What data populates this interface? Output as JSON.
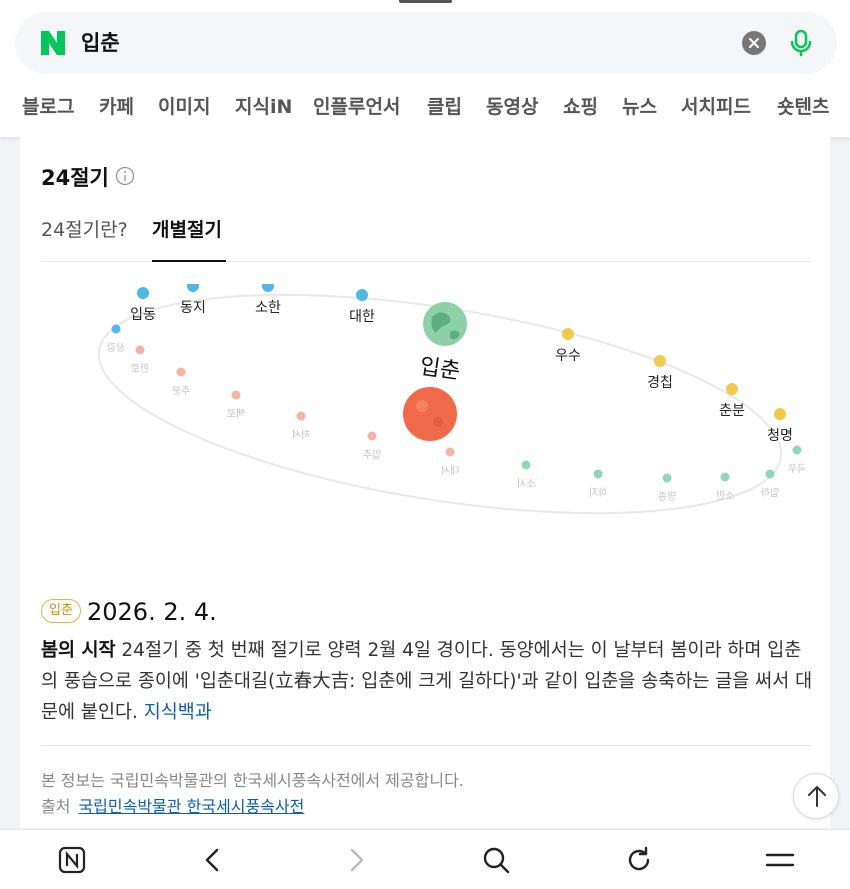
{
  "search": {
    "logo": "N",
    "query": "입춘",
    "clear_icon": "clear-icon",
    "mic_icon": "mic-icon"
  },
  "nav_tabs": [
    "블로그",
    "카페",
    "이미지",
    "지식iN",
    "인플루언서",
    "클립",
    "동영상",
    "쇼핑",
    "뉴스",
    "서치피드",
    "숏텐츠"
  ],
  "card": {
    "title": "24절기",
    "subtabs": [
      "24절기란?",
      "개별절기"
    ],
    "orbit": {
      "center_label": "입춘",
      "terms": [
        "입동",
        "동지",
        "소한",
        "대한",
        "우수",
        "경칩",
        "춘분",
        "청명",
        "곡우",
        "입하",
        "소만",
        "망종",
        "하지",
        "소서",
        "대서",
        "입추",
        "처서",
        "백로",
        "추분",
        "한로",
        "상강"
      ]
    },
    "badge": "입춘",
    "date": "2026. 2. 4.",
    "desc_bold": "봄의 시작",
    "desc_text": " 24절기 중 첫 번째 절기로 양력 2월 4일 경이다. 동양에서는 이 날부터 봄이라 하며 입춘의 풍습으로 종이에 '입춘대길(立春大吉: 입춘에 크게 길하다)'과 같이 입춘을 송축하는 글을 써서 대문에 붙인다. ",
    "desc_link": "지식백과",
    "source_note": "본 정보는 국립민속박물관의 한국세시풍속사전에서 제공합니다.",
    "source_label": "출처",
    "source_link": "국립민속박물관 한국세시풍속사전"
  },
  "colors": {
    "naver_green": "#03c75a",
    "winter": "#4fb8e6",
    "spring": "#f2c94c",
    "summer": "#8fd8b5",
    "autumn": "#f5b3a3",
    "link": "#0b5fb5"
  }
}
